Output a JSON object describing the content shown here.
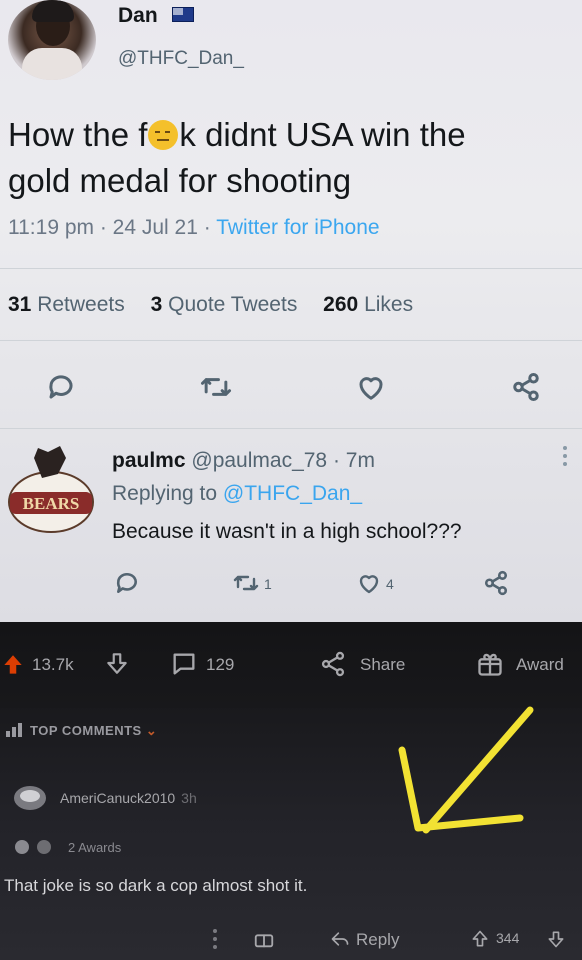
{
  "tweet": {
    "display_name": "Dan",
    "handle": "@THFC_Dan_",
    "text_part1": "How the f",
    "text_part2": "k didnt USA win the",
    "text_line2": "gold medal for shooting",
    "time": "11:19 pm · 24 Jul 21 · ",
    "source": "Twitter for iPhone",
    "retweets_count": "31",
    "retweets_label": "Retweets",
    "quotes_count": "3",
    "quotes_label": "Quote Tweets",
    "likes_count": "260",
    "likes_label": "Likes"
  },
  "reply": {
    "name": "paulmc",
    "handle_time": "@paulmac_78 · 7m",
    "replying_prefix": "Replying to ",
    "replying_mention": "@THFC_Dan_",
    "text": "Because it wasn't in a high school???",
    "retweets": "1",
    "likes": "4",
    "avatar_badge_text": "BEARS"
  },
  "reddit": {
    "upvotes": "13.7k",
    "comments": "129",
    "share_label": "Share",
    "award_label": "Award",
    "top_comments_label": "TOP COMMENTS",
    "commenter": "AmeriCanuck2010",
    "comment_age": "3h",
    "awards_label": "2 Awards",
    "comment_text": "That joke is so dark a cop almost shot it.",
    "reply_label": "Reply",
    "comment_score": "344"
  },
  "colors": {
    "twitter_blue": "#1d9bf0",
    "annotation_yellow": "#f2e233",
    "reddit_bg": "#1a1a1b"
  },
  "icons": [
    "reply-icon",
    "retweet-icon",
    "like-icon",
    "share-icon",
    "upvote-icon",
    "downvote-icon",
    "comment-icon",
    "award-icon",
    "kebab-icon",
    "flag-icon"
  ]
}
